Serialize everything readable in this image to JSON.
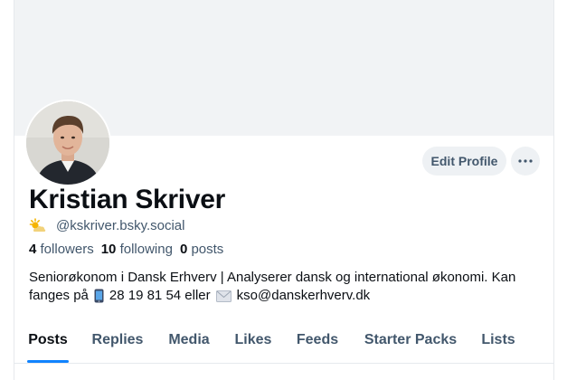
{
  "profile": {
    "display_name": "Kristian Skriver",
    "handle": "@kskriver.bsky.social",
    "handle_emoji": "sun-behind-cloud",
    "avatar": "profile-photo"
  },
  "actions": {
    "edit_profile_label": "Edit Profile",
    "more_label": "···"
  },
  "stats": {
    "followers_count": "4",
    "followers_label": "followers",
    "following_count": "10",
    "following_label": "following",
    "posts_count": "0",
    "posts_label": "posts"
  },
  "bio": {
    "line1": "Seniorøkonom i Dansk Erhverv | Analyserer dansk og international økonomi. Kan",
    "line2_prefix": "fanges på",
    "phone": "28 19 81 54 eller",
    "email": "kso@danskerhverv.dk",
    "phone_icon": "mobile-phone",
    "email_icon": "envelope"
  },
  "tabs": [
    {
      "label": "Posts",
      "active": true
    },
    {
      "label": "Replies",
      "active": false
    },
    {
      "label": "Media",
      "active": false
    },
    {
      "label": "Likes",
      "active": false
    },
    {
      "label": "Feeds",
      "active": false
    },
    {
      "label": "Starter Packs",
      "active": false
    },
    {
      "label": "Lists",
      "active": false
    }
  ],
  "colors": {
    "accent": "#1083fe",
    "text": "#0b0f14",
    "muted": "#42576c",
    "banner": "#f1f3f5",
    "button_bg": "#eef1f4"
  }
}
